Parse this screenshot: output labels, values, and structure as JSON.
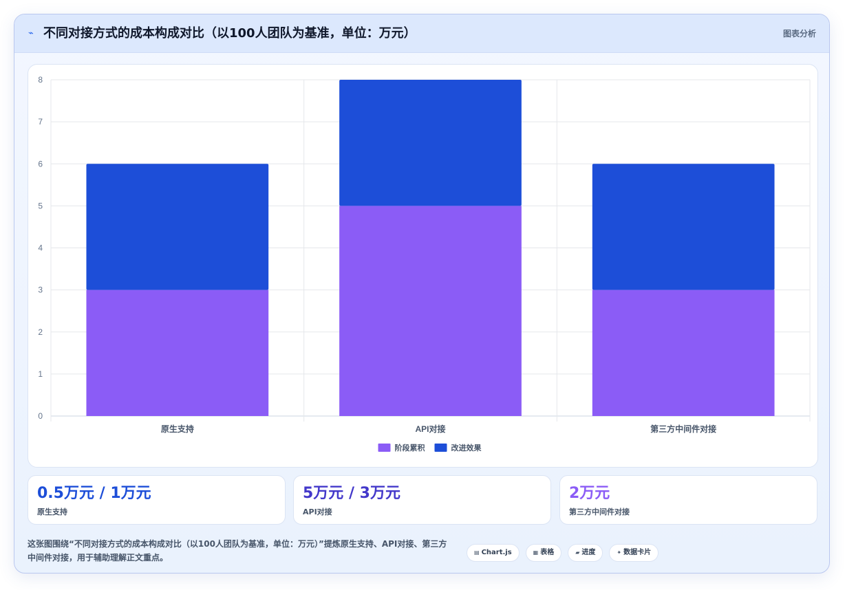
{
  "header": {
    "icon": "chart-icon",
    "title": "不同对接方式的成本构成对比（以100人团队为基准，单位：万元）",
    "tag": "图表分析"
  },
  "chart_data": {
    "type": "bar",
    "stacked": true,
    "categories": [
      "原生支持",
      "API对接",
      "第三方中间件对接"
    ],
    "series": [
      {
        "name": "阶段累积",
        "values": [
          3,
          5,
          3
        ],
        "color": "#8b5cf6"
      },
      {
        "name": "改进效果",
        "values": [
          3,
          3,
          3
        ],
        "color": "#1d4ed8"
      }
    ],
    "ylim": [
      0,
      8
    ],
    "yticks": [
      0,
      1,
      2,
      3,
      4,
      5,
      6,
      7,
      8
    ],
    "grid": true,
    "legend": "bottom"
  },
  "stats": [
    {
      "value": "0.5万元 / 1万元",
      "label": "原生支持",
      "color": "#1d4ed8"
    },
    {
      "value": "5万元 / 3万元",
      "label": "API对接",
      "color": "#4338ca"
    },
    {
      "value": "2万元",
      "label": "第三方中间件对接",
      "color": "#8b5cf6"
    }
  ],
  "footer": {
    "text": "这张图围绕“不同对接方式的成本构成对比（以100人团队为基准，单位：万元）”提炼原生支持、API对接、第三方中间件对接，用于辅助理解正文重点。",
    "chips": [
      {
        "icon": "chart-js-icon",
        "glyph": "▤",
        "label": "Chart.js"
      },
      {
        "icon": "table-icon",
        "glyph": "▦",
        "label": "表格"
      },
      {
        "icon": "progress-icon",
        "glyph": "▰",
        "label": "进度"
      },
      {
        "icon": "data-card-icon",
        "glyph": "✦",
        "label": "数据卡片"
      }
    ]
  }
}
